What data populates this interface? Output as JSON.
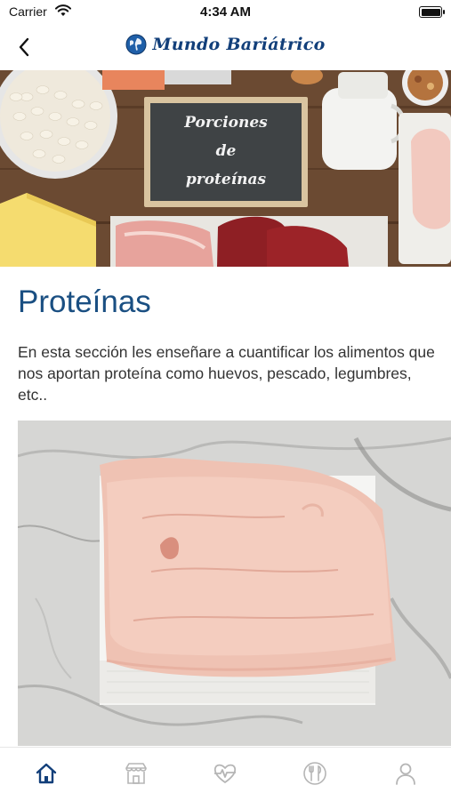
{
  "status_bar": {
    "carrier": "Carrier",
    "time": "4:34 AM"
  },
  "header": {
    "app_title": "Mundo Bariátrico",
    "back_icon": "chevron-left-icon",
    "logo_icon": "globe-icon"
  },
  "hero": {
    "board_lines": [
      "Porciones",
      "de",
      "proteínas"
    ]
  },
  "section": {
    "title": "Proteínas",
    "description": "En esta sección les enseñare a cuantificar los alimentos que nos aportan proteína como huevos, pescado, legumbres, etc.."
  },
  "tab_bar": {
    "active_index": 0,
    "tabs": [
      {
        "icon": "home-icon"
      },
      {
        "icon": "store-icon"
      },
      {
        "icon": "heart-pulse-icon"
      },
      {
        "icon": "cutlery-icon"
      },
      {
        "icon": "user-icon"
      }
    ]
  },
  "colors": {
    "brand": "#123f7a",
    "title": "#1a4f82",
    "tab_active": "#123f7a",
    "tab_inactive": "#b5b5b5"
  }
}
